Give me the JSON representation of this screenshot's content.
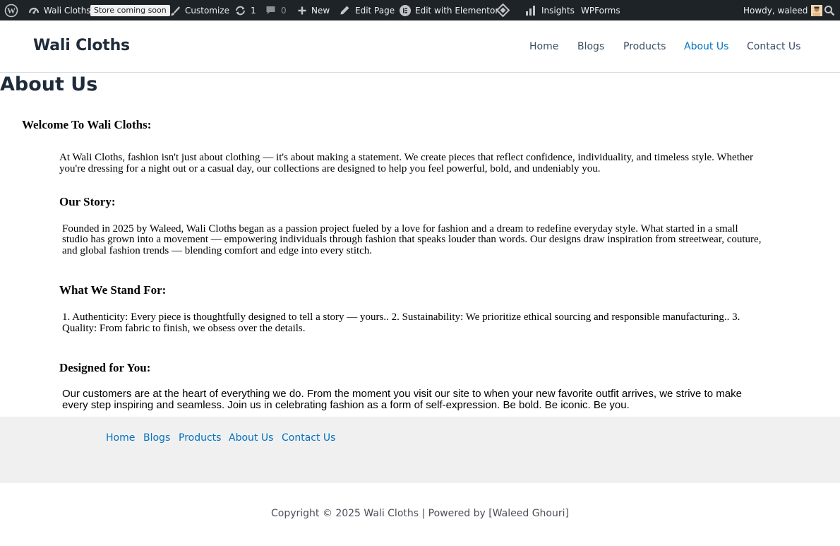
{
  "admin_bar": {
    "site_name": "Wali Cloths",
    "badge": "Store coming soon",
    "customize": "Customize",
    "updates_count": "1",
    "comments_count": "0",
    "new": "New",
    "edit_page": "Edit Page",
    "edit_elementor": "Edit with Elementor",
    "insights": "Insights",
    "wpforms": "WPForms",
    "howdy": "Howdy, waleed"
  },
  "header": {
    "site_title": "Wali Cloths",
    "nav": [
      {
        "label": "Home",
        "active": false
      },
      {
        "label": "Blogs",
        "active": false
      },
      {
        "label": "Products",
        "active": false
      },
      {
        "label": "About Us",
        "active": true
      },
      {
        "label": "Contact Us",
        "active": false
      }
    ],
    "active_color": "#0274be"
  },
  "page": {
    "title": "About Us",
    "welcome_heading": "Welcome To Wali Cloths:",
    "intro_line1": "At Wali Cloths, fashion isn't just about clothing — it's about making a statement. We create pieces that reflect confidence, individuality, and timeless style. Whether",
    "intro_line2": "you're dressing for a night out or a casual day, our collections are designed to help you feel powerful, bold, and undeniably you.",
    "story_heading": "Our Story:",
    "story_line1": "Founded in 2025 by Waleed, Wali Cloths began as a passion project fueled by a love for fashion and a dream to redefine everyday style. What started in a small",
    "story_line2": "studio has grown into a movement — empowering individuals through fashion that speaks louder than words. Our designs draw inspiration from streetwear, couture,",
    "story_line3": "and global fashion trends — blending comfort and edge into every stitch.",
    "stand_heading": "What We Stand For:",
    "stand_line1": "1. Authenticity: Every piece is thoughtfully designed to tell a story — yours.. 2. Sustainability: We prioritize ethical sourcing and responsible manufacturing.. 3.",
    "stand_line2": "Quality: From fabric to finish, we obsess over the details.",
    "designed_heading": "Designed for You:",
    "designed_line1": "Our customers are at the heart of everything we do. From the moment you visit our site to when your new favorite outfit arrives, we strive to make",
    "designed_line2": "every step inspiring and seamless. Join us in celebrating fashion as a form of self-expression. Be bold. Be iconic. Be you."
  },
  "footer": {
    "nav": [
      "Home",
      "Blogs",
      "Products",
      "About Us",
      "Contact Us"
    ],
    "copyright": "Copyright © 2025 Wali Cloths | Powered by [Waleed Ghouri]"
  },
  "icons": {
    "wp_logo": "wordpress-icon",
    "site": "dashboard-icon",
    "customize": "brush-icon",
    "updates": "refresh-icon",
    "comments": "comment-icon",
    "new": "plus-icon",
    "edit": "pencil-icon",
    "elementor": "elementor-icon",
    "diamond": "diamond-icon",
    "insights": "bar-chart-icon",
    "avatar": "avatar",
    "search": "search-icon"
  }
}
